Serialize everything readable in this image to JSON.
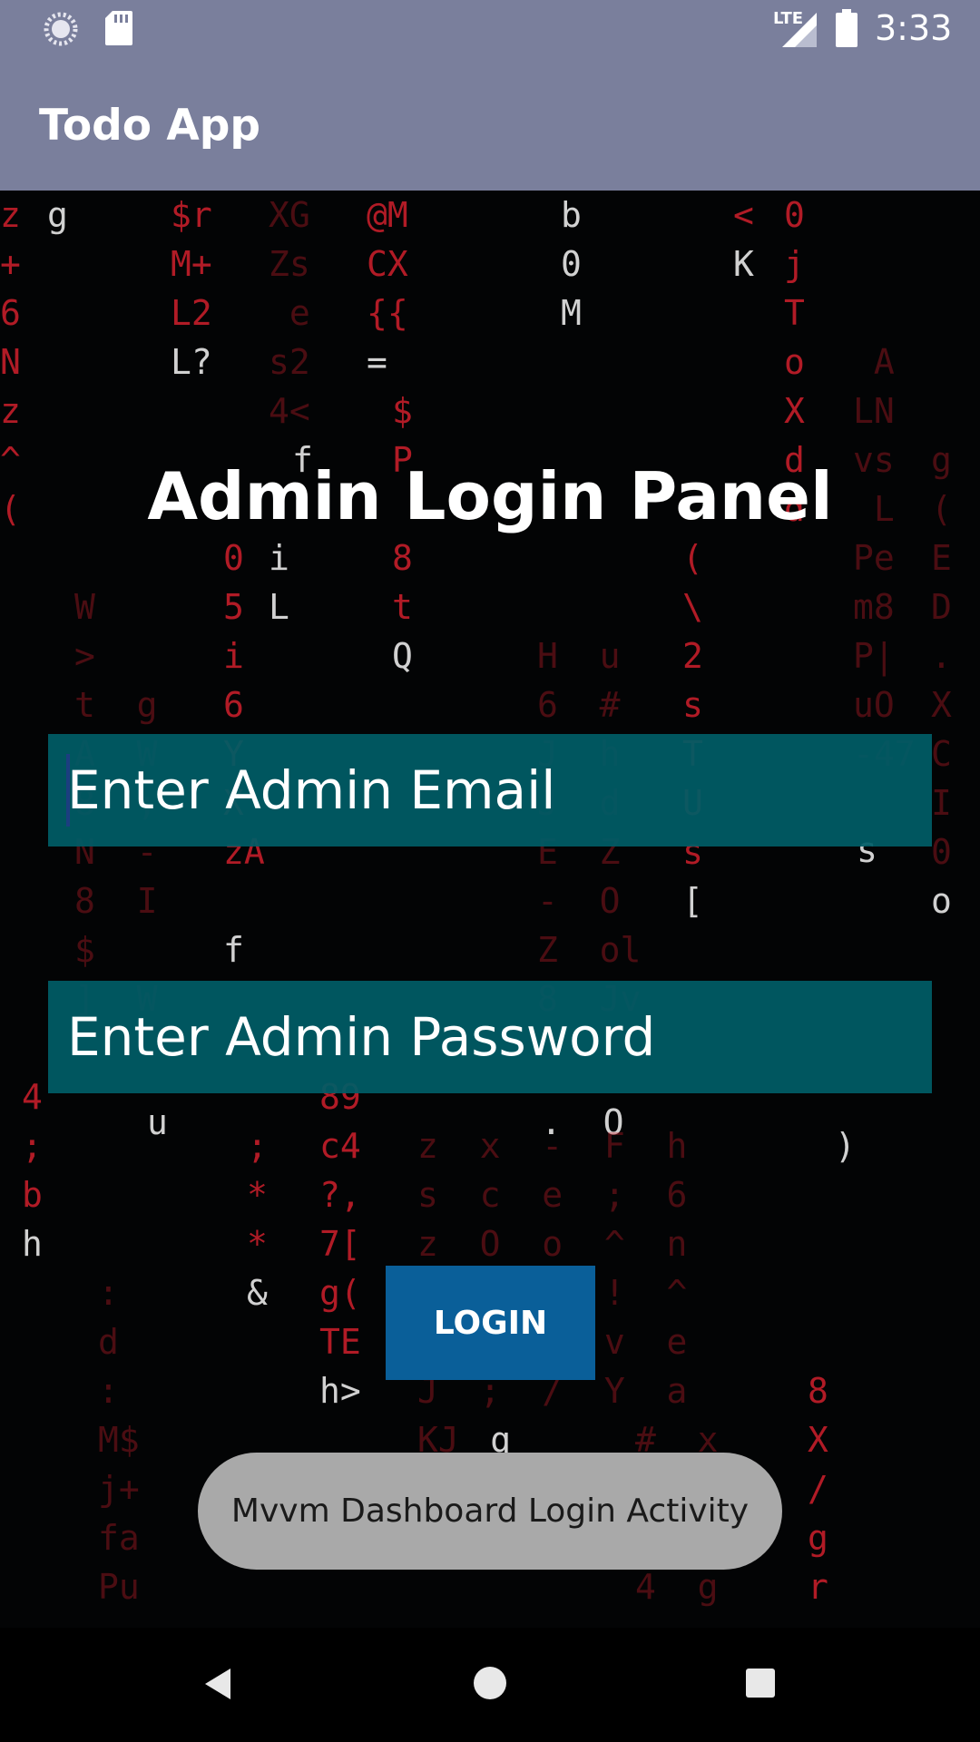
{
  "status_bar": {
    "time": "3:33",
    "network": "LTE",
    "icons": [
      "sync-icon",
      "sd-card-icon",
      "signal-icon",
      "battery-icon"
    ]
  },
  "app_bar": {
    "title": "Todo App"
  },
  "login": {
    "heading": "Admin Login Panel",
    "email_placeholder": "Enter Admin Email",
    "email_value": "",
    "password_placeholder": "Enter Admin Password",
    "password_value": "",
    "login_button": "LOGIN"
  },
  "toast": {
    "message": "Mvvm Dashboard Login Activity"
  },
  "nav_bar": {
    "icons": [
      "back-icon",
      "home-icon",
      "recents-icon"
    ]
  },
  "colors": {
    "app_bar": "#7a7f9c",
    "input_background": "#005c66",
    "button_background": "#0a5f99",
    "toast_background": "#a9a9a9",
    "matrix_red": "#d0202c"
  }
}
